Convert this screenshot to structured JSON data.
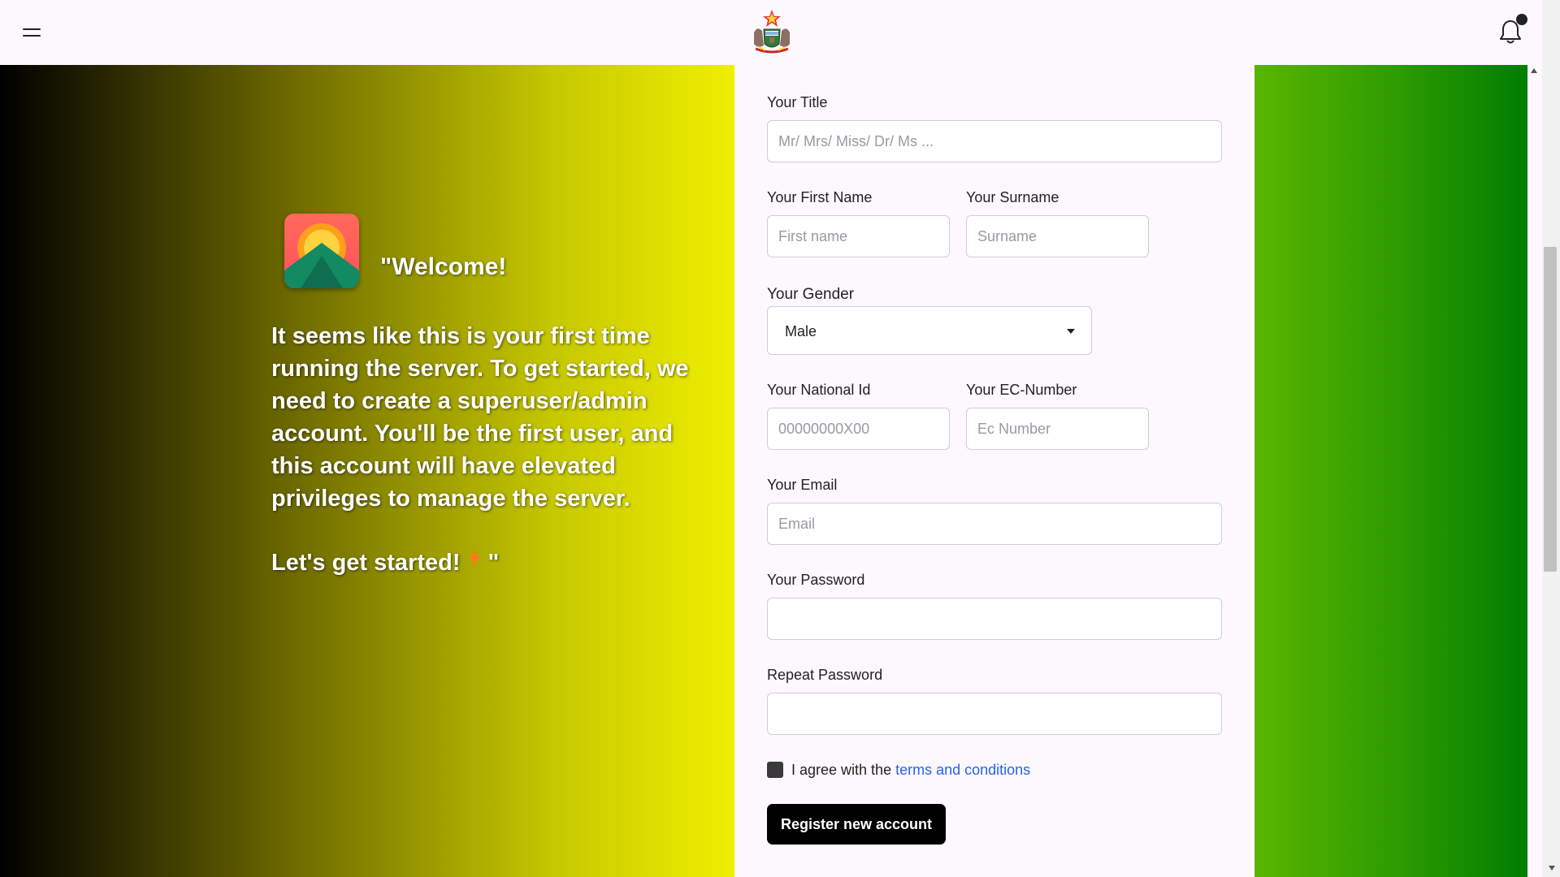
{
  "header": {
    "menu_icon": "hamburger-icon",
    "logo_icon": "coat-of-arms-logo",
    "notification_icon": "bell-icon"
  },
  "welcome": {
    "icon": "sunrise-mountain-icon",
    "title": "\"Welcome!",
    "body": "It seems like this is your first time running the server. To get started, we need to create a superuser/admin account. You'll be the first user, and this account will have elevated privileges to manage the server.",
    "cta": "Let's get started!",
    "cta_end": "\"",
    "bolt_icon": "lightning-bolt-icon"
  },
  "form": {
    "title_label": "Your Title",
    "title_placeholder": "Mr/ Mrs/ Miss/ Dr/ Ms ...",
    "first_name_label": "Your First Name",
    "first_name_placeholder": "First name",
    "surname_label": "Your Surname",
    "surname_placeholder": "Surname",
    "gender_label": "Your Gender",
    "gender_value": "Male",
    "national_id_label": "Your National Id",
    "national_id_placeholder": "00000000X00",
    "ec_number_label": "Your EC-Number",
    "ec_number_placeholder": "Ec Number",
    "email_label": "Your Email",
    "email_placeholder": "Email",
    "password_label": "Your Password",
    "repeat_password_label": "Repeat Password",
    "agree_text": "I agree with the ",
    "terms_link": "terms and conditions",
    "register_button": "Register new account"
  },
  "colors": {
    "left_gradient_start": "#000000",
    "left_gradient_end": "#f0ef00",
    "right_gradient_start": "#5ab500",
    "right_gradient_end": "#007d00",
    "button_bg": "#000000",
    "link": "#2563eb"
  }
}
